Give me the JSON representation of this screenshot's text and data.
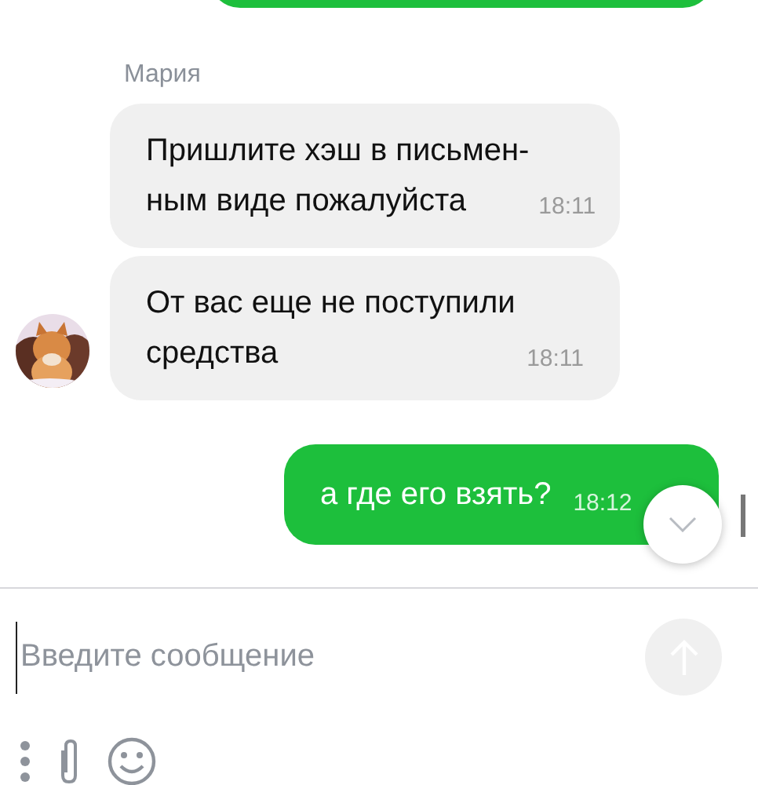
{
  "messages": [
    {
      "kind": "incoming",
      "sender": "Мария",
      "lines": [
        "Пришлите хэш в письмен-",
        "ным виде пожалуйста"
      ],
      "time": "18:11"
    },
    {
      "kind": "incoming",
      "lines": [
        "От вас еще не поступили",
        "средства"
      ],
      "time": "18:11"
    },
    {
      "kind": "outgoing",
      "lines": [
        "а где его взять?"
      ],
      "time": "18:12"
    }
  ],
  "composer": {
    "placeholder": "Введите сообщение"
  }
}
